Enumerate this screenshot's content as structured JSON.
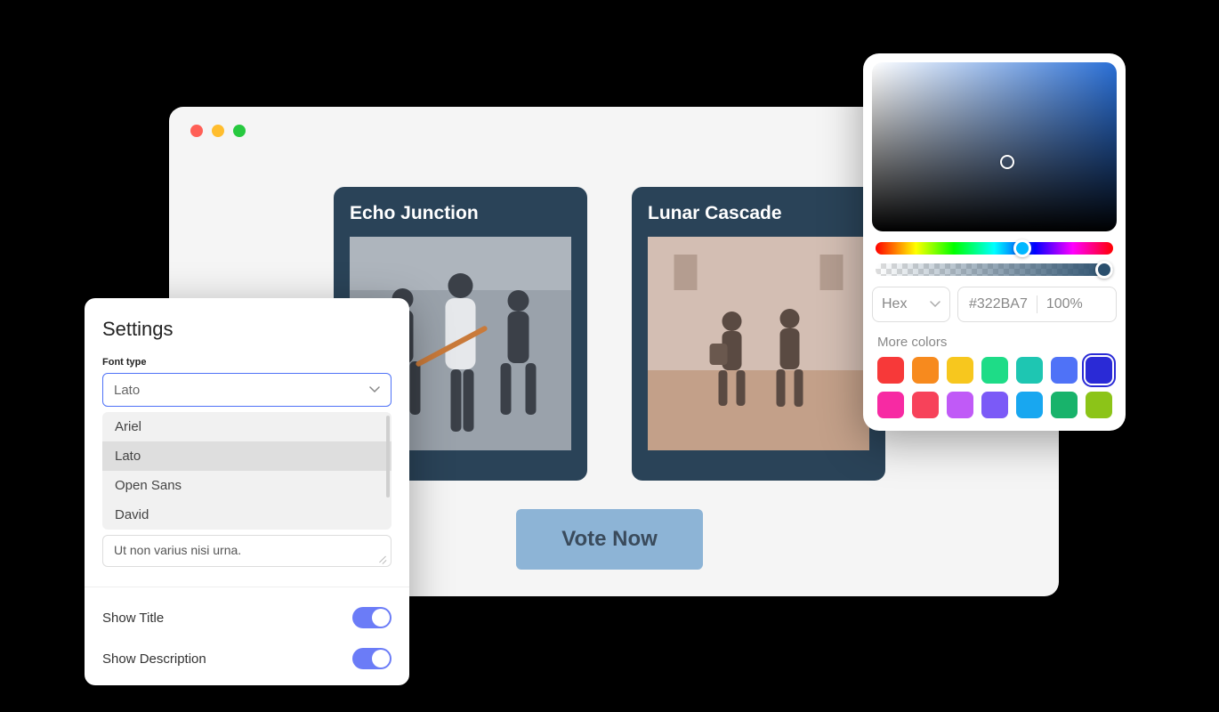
{
  "browser": {
    "cards": [
      {
        "title": "Echo Junction"
      },
      {
        "title": "Lunar Cascade"
      }
    ],
    "cta_label": "Vote Now"
  },
  "settings": {
    "title": "Settings",
    "font_type_label": "Font type",
    "font_selected": "Lato",
    "font_options": [
      "Ariel",
      "Lato",
      "Open Sans",
      "David"
    ],
    "font_selected_index": 1,
    "textarea_value": "Ut non varius nisi urna.",
    "toggles": [
      {
        "label": "Show Title",
        "value": true
      },
      {
        "label": "Show Description",
        "value": true
      }
    ]
  },
  "color_picker": {
    "format_label": "Hex",
    "hex_value": "#322BA7",
    "alpha_value": "100%",
    "more_colors_label": "More colors",
    "swatches": [
      "#f73939",
      "#f78a1e",
      "#f7c71e",
      "#1edc87",
      "#1ec6b2",
      "#4f72f7",
      "#2a2ad6",
      "#f72aa3",
      "#f7425a",
      "#c05af7",
      "#7b5af7",
      "#18a7f0",
      "#18b36b",
      "#8cc418"
    ],
    "selected_swatch_index": 6
  }
}
